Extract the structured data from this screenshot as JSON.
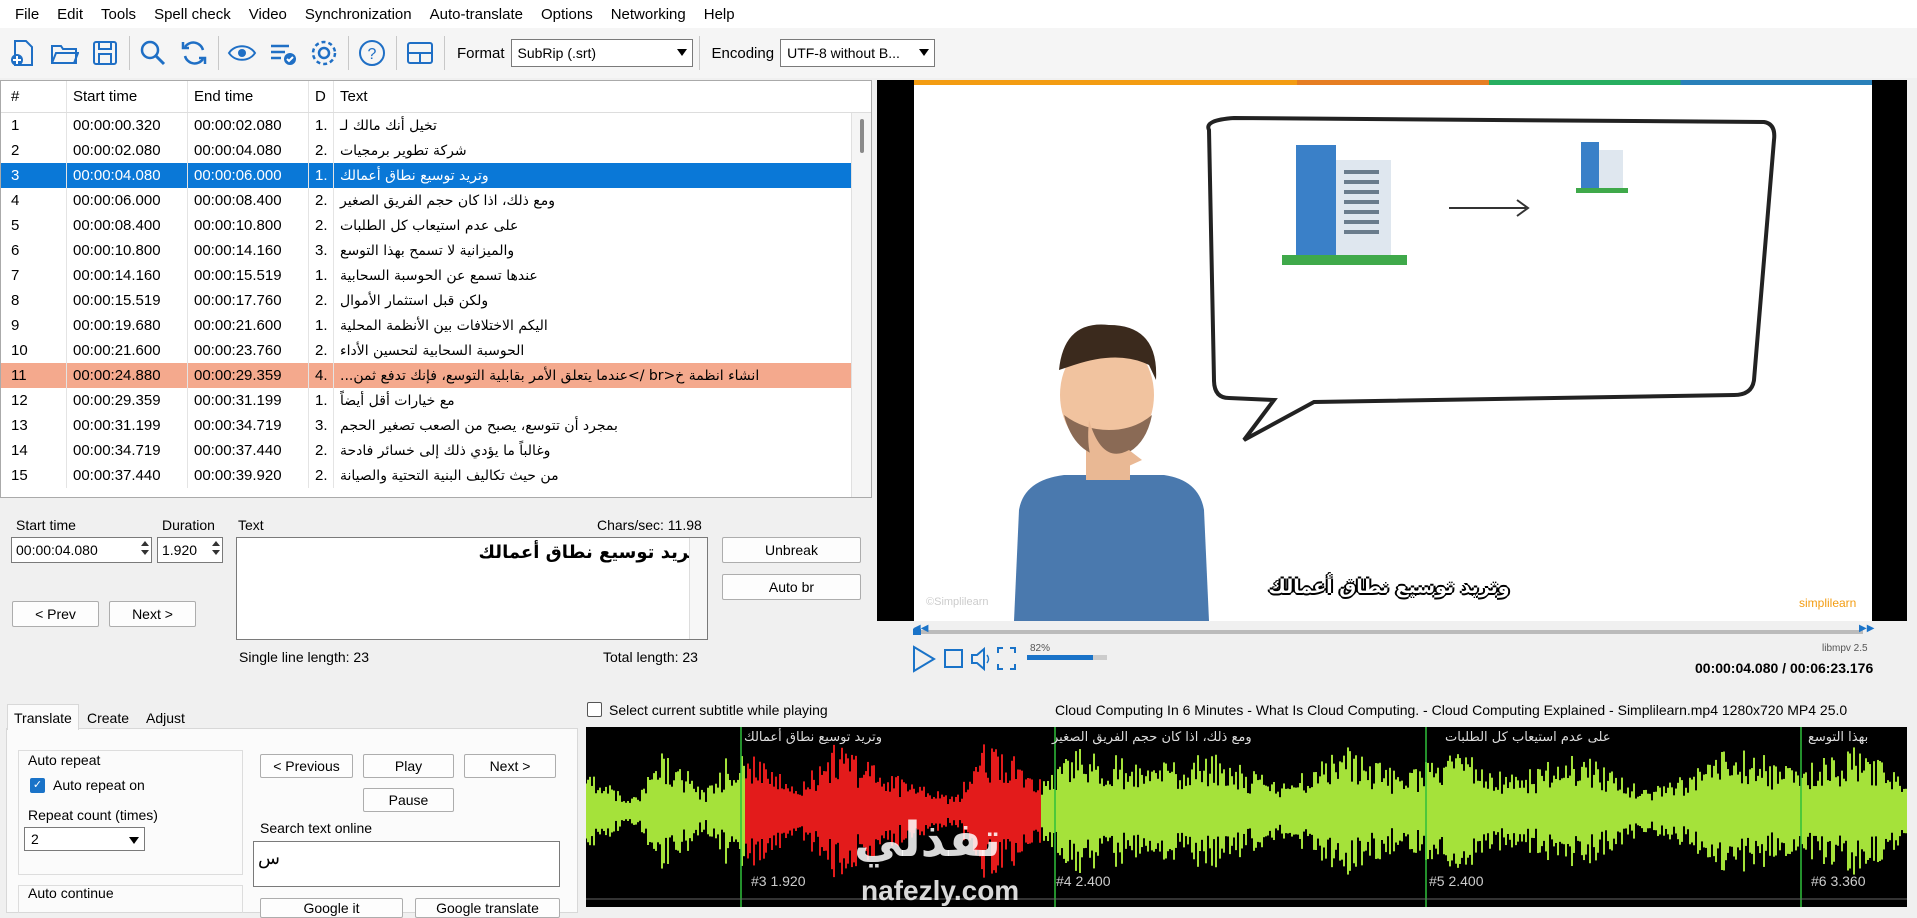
{
  "menu": [
    "File",
    "Edit",
    "Tools",
    "Spell check",
    "Video",
    "Synchronization",
    "Auto-translate",
    "Options",
    "Networking",
    "Help"
  ],
  "toolbar": {
    "icons": [
      "new-file-icon",
      "open-folder-icon",
      "save-icon",
      "find-icon",
      "replace-icon",
      "preview-icon",
      "spellcheck-icon",
      "settings-icon",
      "help-icon",
      "layout-icon"
    ],
    "format_label": "Format",
    "format_value": "SubRip (.srt)",
    "encoding_label": "Encoding",
    "encoding_value": "UTF-8 without B..."
  },
  "grid": {
    "headers": [
      "#",
      "Start time",
      "End time",
      "D",
      "Text"
    ],
    "rows": [
      {
        "n": "1",
        "start": "00:00:00.320",
        "end": "00:00:02.080",
        "d": "1.",
        "text": "تخيل أنك مالك لـ"
      },
      {
        "n": "2",
        "start": "00:00:02.080",
        "end": "00:00:04.080",
        "d": "2.",
        "text": "شركة تطوير برمجيات"
      },
      {
        "n": "3",
        "start": "00:00:04.080",
        "end": "00:00:06.000",
        "d": "1.",
        "text": "وتريد توسيع نطاق أعمالك"
      },
      {
        "n": "4",
        "start": "00:00:06.000",
        "end": "00:00:08.400",
        "d": "2.",
        "text": "ومع ذلك، اذا كان حجم الفريق الصغير"
      },
      {
        "n": "5",
        "start": "00:00:08.400",
        "end": "00:00:10.800",
        "d": "2.",
        "text": "على عدم استيعاب كل الطلبات"
      },
      {
        "n": "6",
        "start": "00:00:10.800",
        "end": "00:00:14.160",
        "d": "3.",
        "text": "والميزانية لا تسمح بهذا التوسع"
      },
      {
        "n": "7",
        "start": "00:00:14.160",
        "end": "00:00:15.519",
        "d": "1.",
        "text": "عندها تسمع عن الحوسبة السحابية"
      },
      {
        "n": "8",
        "start": "00:00:15.519",
        "end": "00:00:17.760",
        "d": "2.",
        "text": "ولكن قبل استثمار الأموال"
      },
      {
        "n": "9",
        "start": "00:00:19.680",
        "end": "00:00:21.600",
        "d": "1.",
        "text": "اليكم الاختلافات بين الأنظمة المحلية"
      },
      {
        "n": "10",
        "start": "00:00:21.600",
        "end": "00:00:23.760",
        "d": "2.",
        "text": "الحوسبة السحابية لتحسين الأداء"
      },
      {
        "n": "11",
        "start": "00:00:24.880",
        "end": "00:00:29.359",
        "d": "4.",
        "text": "انشاء انظمة خ<br />عندما يتعلق الأمر بقابلية التوسع، فإنك تدفع ثمن..."
      },
      {
        "n": "12",
        "start": "00:00:29.359",
        "end": "00:00:31.199",
        "d": "1.",
        "text": "مع خيارات أقل أيضاً"
      },
      {
        "n": "13",
        "start": "00:00:31.199",
        "end": "00:00:34.719",
        "d": "3.",
        "text": "بمجرد أن تتوسع، يصبح من الصعب تصغير الحجم"
      },
      {
        "n": "14",
        "start": "00:00:34.719",
        "end": "00:00:37.440",
        "d": "2.",
        "text": "وغالباً ما يؤدي ذلك إلى خسائر فادحة"
      },
      {
        "n": "15",
        "start": "00:00:37.440",
        "end": "00:00:39.920",
        "d": "2.",
        "text": "من حيث تكاليف البنية التحتية والصيانة"
      }
    ]
  },
  "edit": {
    "start_label": "Start time",
    "start_value": "00:00:04.080",
    "duration_label": "Duration",
    "duration_value": "1.920",
    "text_label": "Text",
    "chars_sec": "Chars/sec: 11.98",
    "text_value": "وتريد توسيع نطاق أعمالك",
    "unbreak": "Unbreak",
    "auto_br": "Auto br",
    "prev": "< Prev",
    "next": "Next >",
    "single_line": "Single line length: 23",
    "total_length": "Total length: 23"
  },
  "video": {
    "subtitle": "وتريد توسيع نطاق أعمالك",
    "brand": "simplilearn",
    "watermark": "©Simplilearn",
    "volume": "82%",
    "player": "libmpv 2.5",
    "time": "00:00:04.080 / 00:06:23.176"
  },
  "bottom": {
    "tabs": [
      "Translate",
      "Create",
      "Adjust"
    ],
    "auto_repeat_title": "Auto repeat",
    "auto_repeat_on": "Auto repeat on",
    "repeat_count_label": "Repeat count (times)",
    "repeat_count_value": "2",
    "auto_continue": "Auto continue",
    "previous": "< Previous",
    "play": "Play",
    "next": "Next >",
    "pause": "Pause",
    "search_online": "Search text online",
    "search_value": "س",
    "google_it": "Google it",
    "google_translate": "Google translate",
    "select_current": "Select current subtitle while playing",
    "file_info": "Cloud Computing In 6 Minutes - What Is Cloud Computing. - Cloud Computing Explained - Simplilearn.mp4 1280x720 MP4 25.0"
  },
  "waveform": {
    "top_labels": [
      "وتريد توسيع نطاق أعمالك",
      "ومع ذلك، اذا كان حجم الفريق الصغير",
      "على عدم استيعاب كل الطلبات",
      "بهذا التوسع"
    ],
    "bottom_labels": [
      "#3  1.920",
      "#4  2.400",
      "#5  2.400",
      "#6  3.360"
    ],
    "watermark": "تفذلي",
    "watermark_sub": "nafezly.com"
  }
}
